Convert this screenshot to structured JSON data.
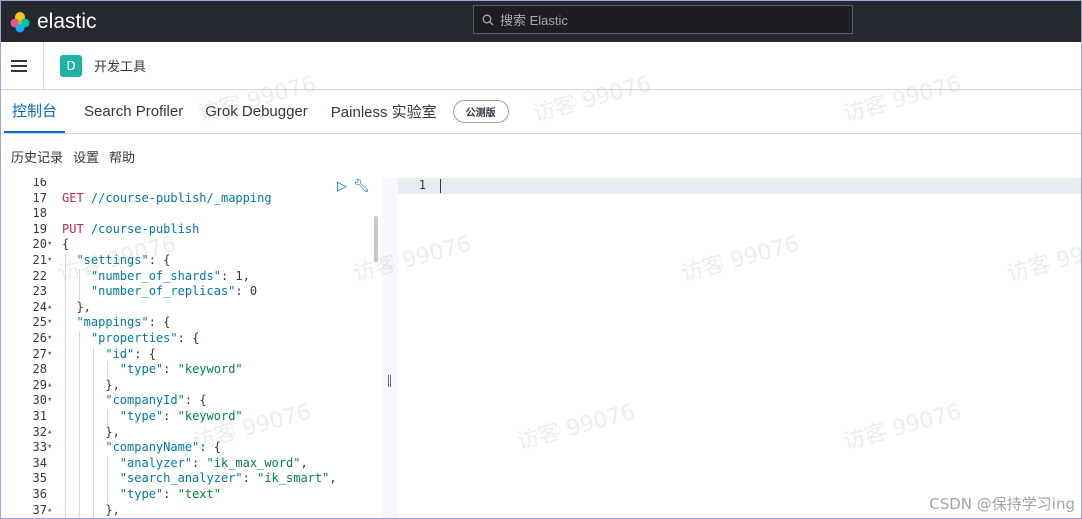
{
  "topbar": {
    "brand": "elastic",
    "search_placeholder": "搜索 Elastic"
  },
  "breadcrumb": {
    "space_badge": "D",
    "current": "开发工具"
  },
  "tabs": [
    {
      "label": "控制台",
      "active": true
    },
    {
      "label": "Search Profiler",
      "active": false
    },
    {
      "label": "Grok Debugger",
      "active": false
    },
    {
      "label": "Painless 实验室",
      "active": false
    }
  ],
  "beta_badge": "公测版",
  "subnav": [
    "历史记录",
    "设置",
    "帮助"
  ],
  "editor_lines": [
    {
      "n": "16",
      "fold": "",
      "text": ""
    },
    {
      "n": "17",
      "fold": "",
      "text": "GET //course-publish/_mapping"
    },
    {
      "n": "18",
      "fold": "",
      "text": ""
    },
    {
      "n": "19",
      "fold": "",
      "text": "PUT /course-publish"
    },
    {
      "n": "20",
      "fold": "▾",
      "text": "{"
    },
    {
      "n": "21",
      "fold": "▾",
      "text": "  \"settings\": {"
    },
    {
      "n": "22",
      "fold": "",
      "text": "    \"number_of_shards\": 1,"
    },
    {
      "n": "23",
      "fold": "",
      "text": "    \"number_of_replicas\": 0"
    },
    {
      "n": "24",
      "fold": "▴",
      "text": "  },"
    },
    {
      "n": "25",
      "fold": "▾",
      "text": "  \"mappings\": {"
    },
    {
      "n": "26",
      "fold": "▾",
      "text": "    \"properties\": {"
    },
    {
      "n": "27",
      "fold": "▾",
      "text": "      \"id\": {"
    },
    {
      "n": "28",
      "fold": "",
      "text": "        \"type\": \"keyword\""
    },
    {
      "n": "29",
      "fold": "▴",
      "text": "      },"
    },
    {
      "n": "30",
      "fold": "▾",
      "text": "      \"companyId\": {"
    },
    {
      "n": "31",
      "fold": "",
      "text": "        \"type\": \"keyword\""
    },
    {
      "n": "32",
      "fold": "▴",
      "text": "      },"
    },
    {
      "n": "33",
      "fold": "▾",
      "text": "      \"companyName\": {"
    },
    {
      "n": "34",
      "fold": "",
      "text": "        \"analyzer\": \"ik_max_word\","
    },
    {
      "n": "35",
      "fold": "",
      "text": "        \"search_analyzer\": \"ik_smart\","
    },
    {
      "n": "36",
      "fold": "",
      "text": "        \"type\": \"text\""
    },
    {
      "n": "37",
      "fold": "▴",
      "text": "      },"
    }
  ],
  "output_line_number": "1",
  "watermark": "访客 99076",
  "credit": "CSDN @保持学习ing",
  "colors": {
    "topbar": "#25282f",
    "accent": "#006bb8",
    "badge": "#20b3a5",
    "method": "#c7254e",
    "key": "#0079a5",
    "string": "#00863a"
  }
}
